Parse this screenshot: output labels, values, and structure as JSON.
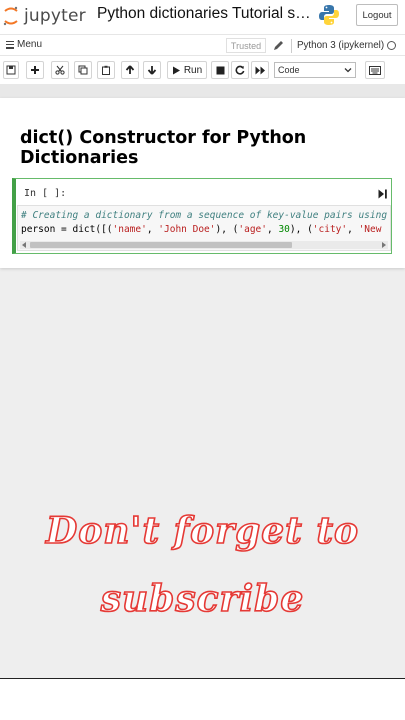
{
  "header": {
    "logo_text": "jupyter",
    "notebook_title": "Python dictionaries Tutorial ser…",
    "logout_label": "Logout"
  },
  "menubar": {
    "menu_label": "Menu",
    "trusted_label": "Trusted",
    "kernel_name": "Python 3 (ipykernel)"
  },
  "toolbar": {
    "run_label": "Run",
    "cell_type": "Code"
  },
  "notebook": {
    "heading": "dict() Constructor for Python Dictionaries",
    "code_cell": {
      "prompt": "In [ ]:",
      "line1": "# Creating a dictionary from a sequence of key-value pairs using",
      "line2_parts": {
        "a": "person = dict([(",
        "s1": "'name'",
        "b": ", ",
        "s2": "'John Doe'",
        "c": "), (",
        "s3": "'age'",
        "d": ", ",
        "n1": "30",
        "e": "), (",
        "s4": "'city'",
        "f": ", ",
        "s5": "'New"
      }
    }
  },
  "overlay": {
    "line1": "Don't forget to",
    "line2": "subscribe"
  },
  "colors": {
    "accent_green": "#43a047",
    "overlay_red": "#e53935",
    "comment": "#408080",
    "string": "#ba2121"
  }
}
